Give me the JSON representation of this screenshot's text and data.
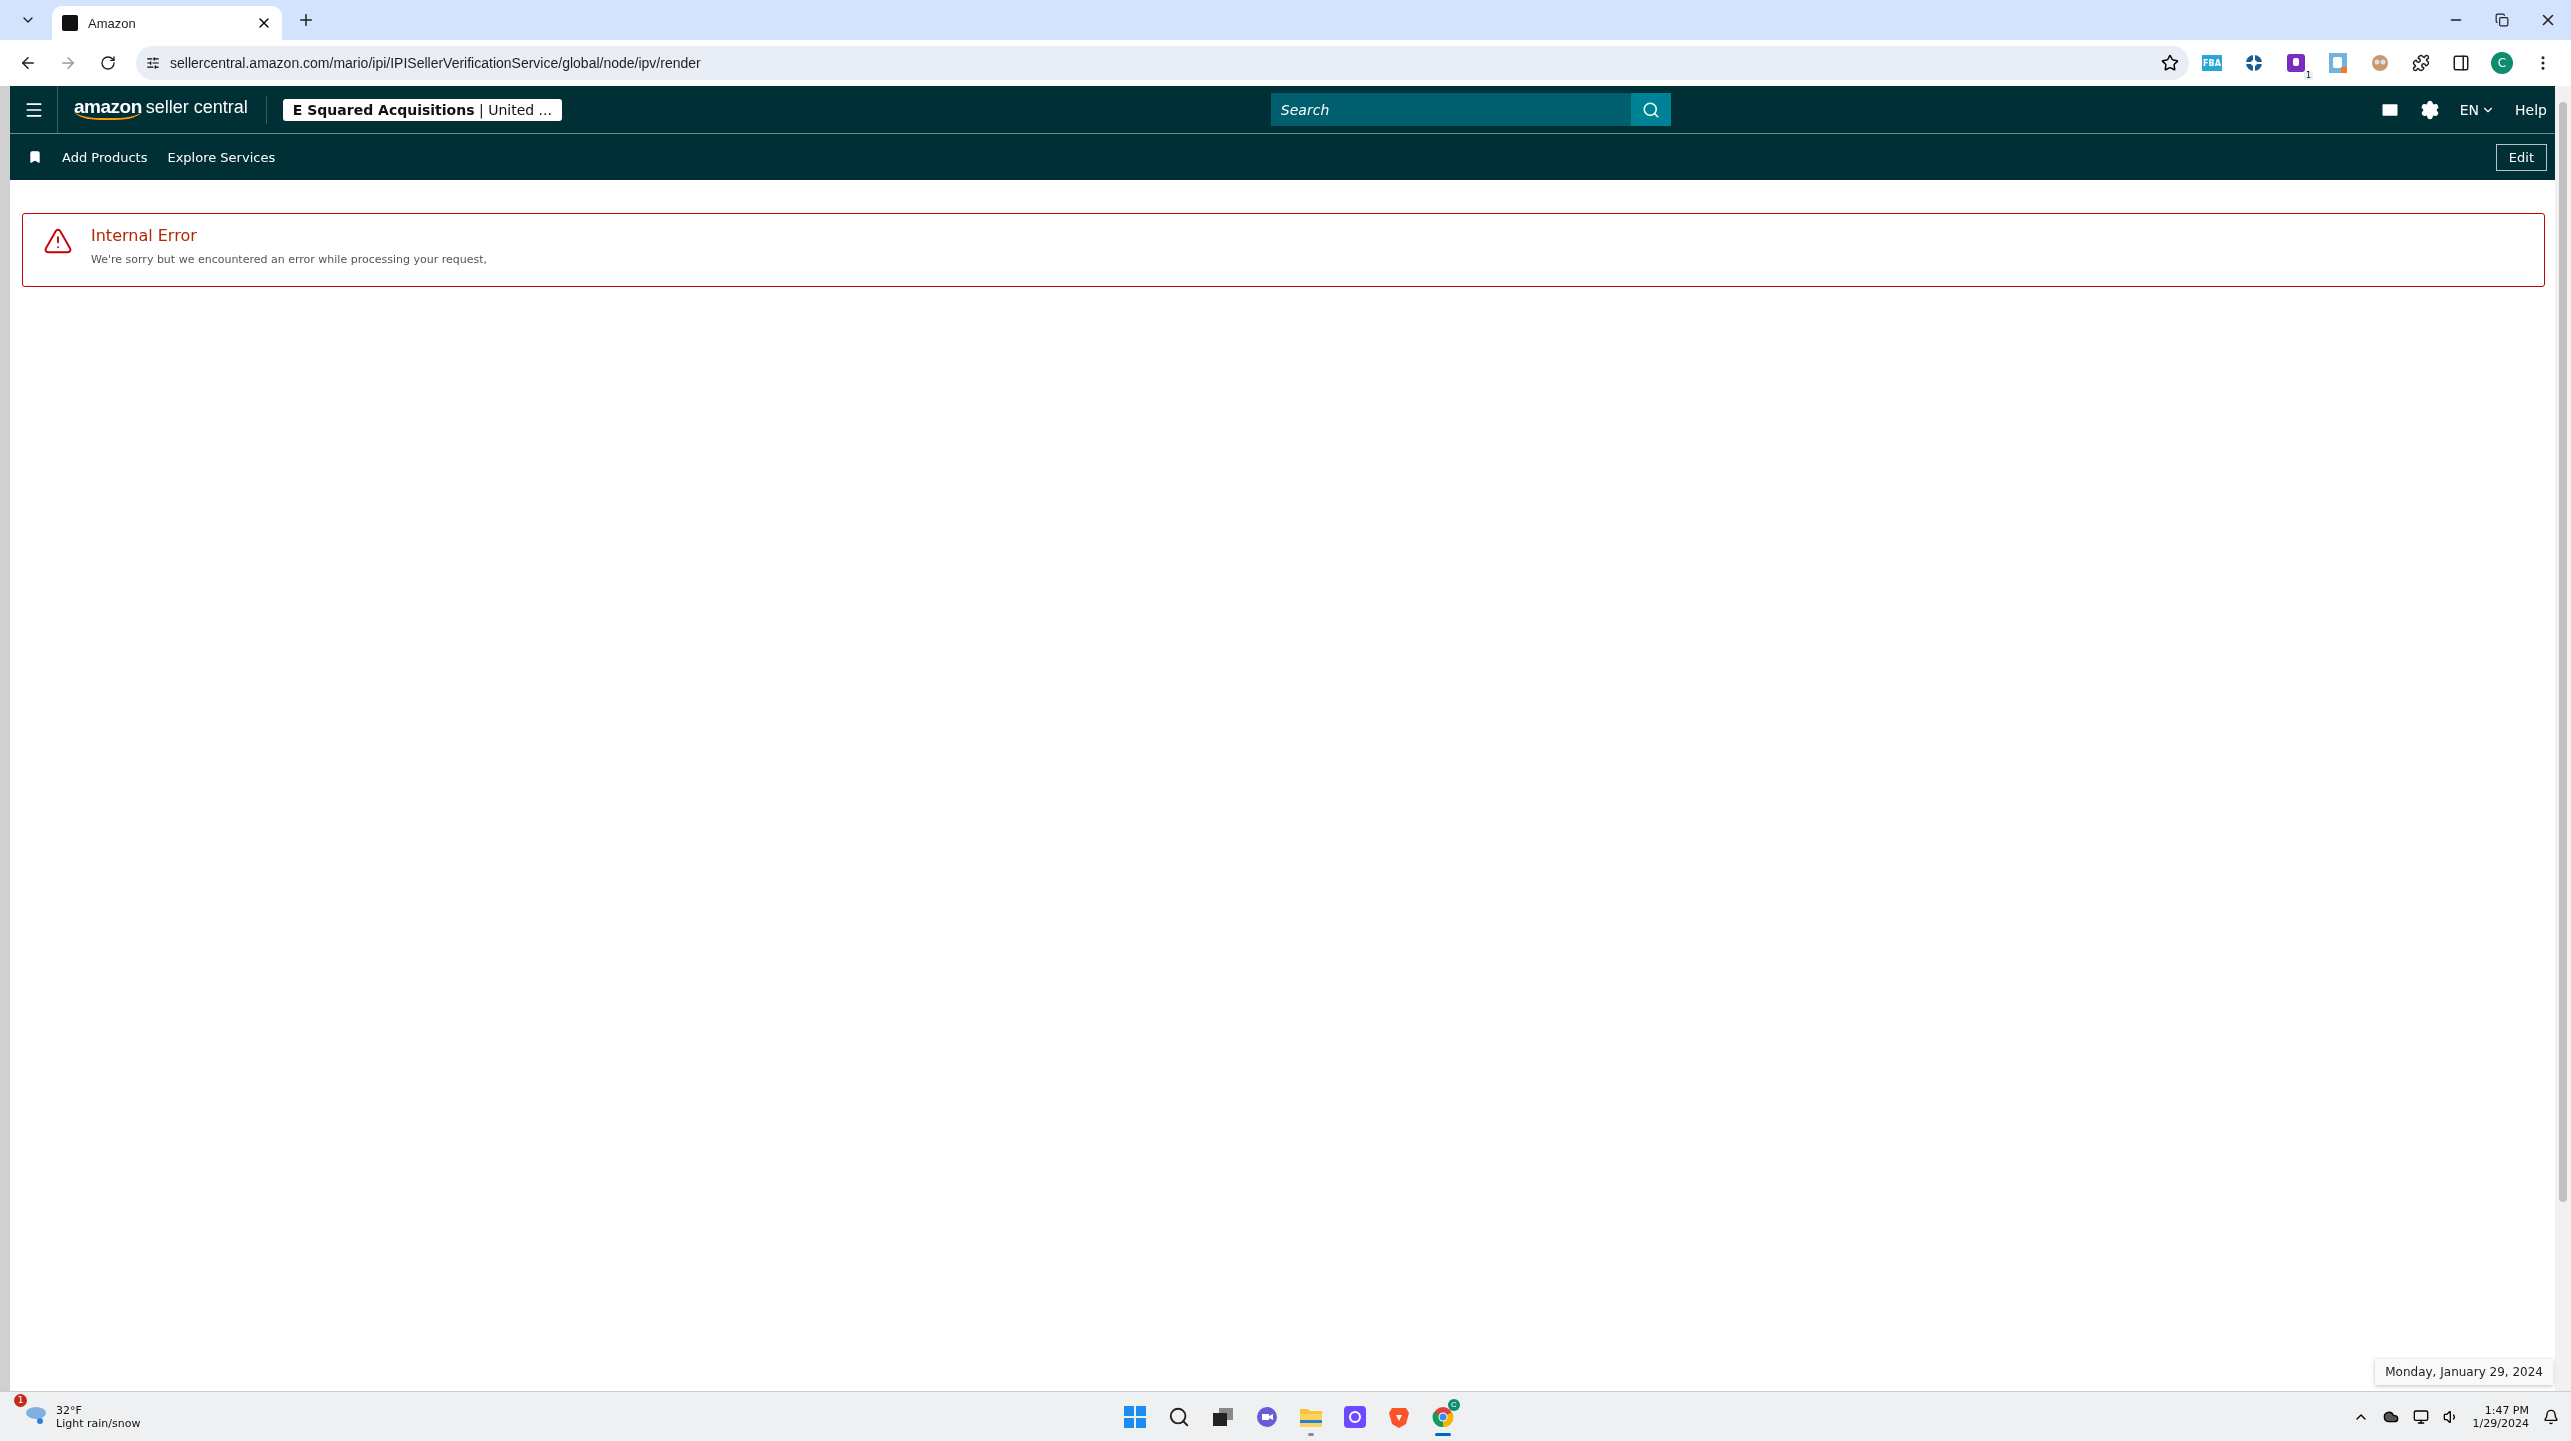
{
  "browser": {
    "tab": {
      "title": "Amazon"
    },
    "url": "sellercentral.amazon.com/mario/ipi/IPISellerVerificationService/global/node/ipv/render",
    "bookmarked": false,
    "extensions": [
      {
        "kind": "fba",
        "label": "FBA"
      },
      {
        "kind": "wheel"
      },
      {
        "kind": "purple",
        "badge": "1"
      },
      {
        "kind": "fist"
      },
      {
        "kind": "face"
      },
      {
        "kind": "puzzle"
      }
    ],
    "profile": "C"
  },
  "header": {
    "logo_brand": "amazon",
    "logo_product": "seller central",
    "account_name": "E Squared Acquisitions",
    "account_region": "| United ...",
    "search": {
      "placeholder": "Search"
    },
    "language": "EN",
    "help": "Help"
  },
  "nav": {
    "items": [
      "Add Products",
      "Explore Services"
    ],
    "edit": "Edit"
  },
  "error": {
    "title": "Internal Error",
    "message": "We're sorry but we encountered an error while processing your request,"
  },
  "tooltip": "Monday, January 29, 2024",
  "taskbar": {
    "weather": {
      "badge": "1",
      "temperature": "32°F",
      "condition": "Light rain/snow"
    },
    "apps": [
      {
        "kind": "start",
        "open": false,
        "selected": false
      },
      {
        "kind": "search",
        "open": false,
        "selected": false
      },
      {
        "kind": "taskview",
        "open": false,
        "selected": false
      },
      {
        "kind": "chat",
        "open": false,
        "selected": false
      },
      {
        "kind": "explorer",
        "open": true,
        "selected": false
      },
      {
        "kind": "proton",
        "open": false,
        "selected": false
      },
      {
        "kind": "brave",
        "open": false,
        "selected": false
      },
      {
        "kind": "chrome",
        "open": true,
        "selected": true,
        "badge": "C"
      }
    ],
    "time": "1:47 PM",
    "date": "1/29/2024"
  }
}
